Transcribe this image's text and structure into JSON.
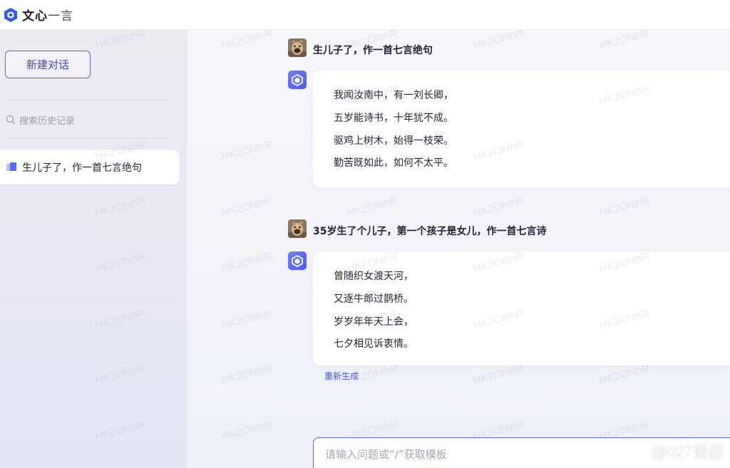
{
  "app": {
    "name_bold": "文心",
    "name_light": "一言",
    "brand_color": "#4a55d8"
  },
  "sidebar": {
    "new_chat_label": "新建对话",
    "search_placeholder": "搜索历史记录",
    "history": [
      {
        "label": "生儿子了，作一首七言绝句"
      }
    ]
  },
  "conversation": [
    {
      "user": "生儿子了，作一首七言绝句",
      "reply": [
        "我闻汝南中，有一刘长卿，",
        "五岁能诗书，十年犹不成。",
        "驱鸡上树木，始得一枝荣。",
        "勤苦既如此，如何不太平。"
      ]
    },
    {
      "user": "35岁生了个儿子，第一个孩子是女儿，作一首七言诗",
      "reply": [
        "曾随织女渡天河，",
        "又逐牛郎过鹊桥。",
        "岁岁年年天上会，",
        "七夕相见诉衷情。"
      ],
      "regenerate_label": "重新生成"
    }
  ],
  "input": {
    "placeholder": "请输入问题或“/”获取模板"
  },
  "watermark": {
    "text": "HK2OhthR",
    "corner_text": "@027菊座"
  },
  "icons": {
    "logo": "wenxin-logo-icon",
    "search": "search-icon",
    "history_item": "book-icon",
    "bot": "bot-avatar-icon",
    "user": "user-avatar",
    "corner": "weibo-icon"
  }
}
